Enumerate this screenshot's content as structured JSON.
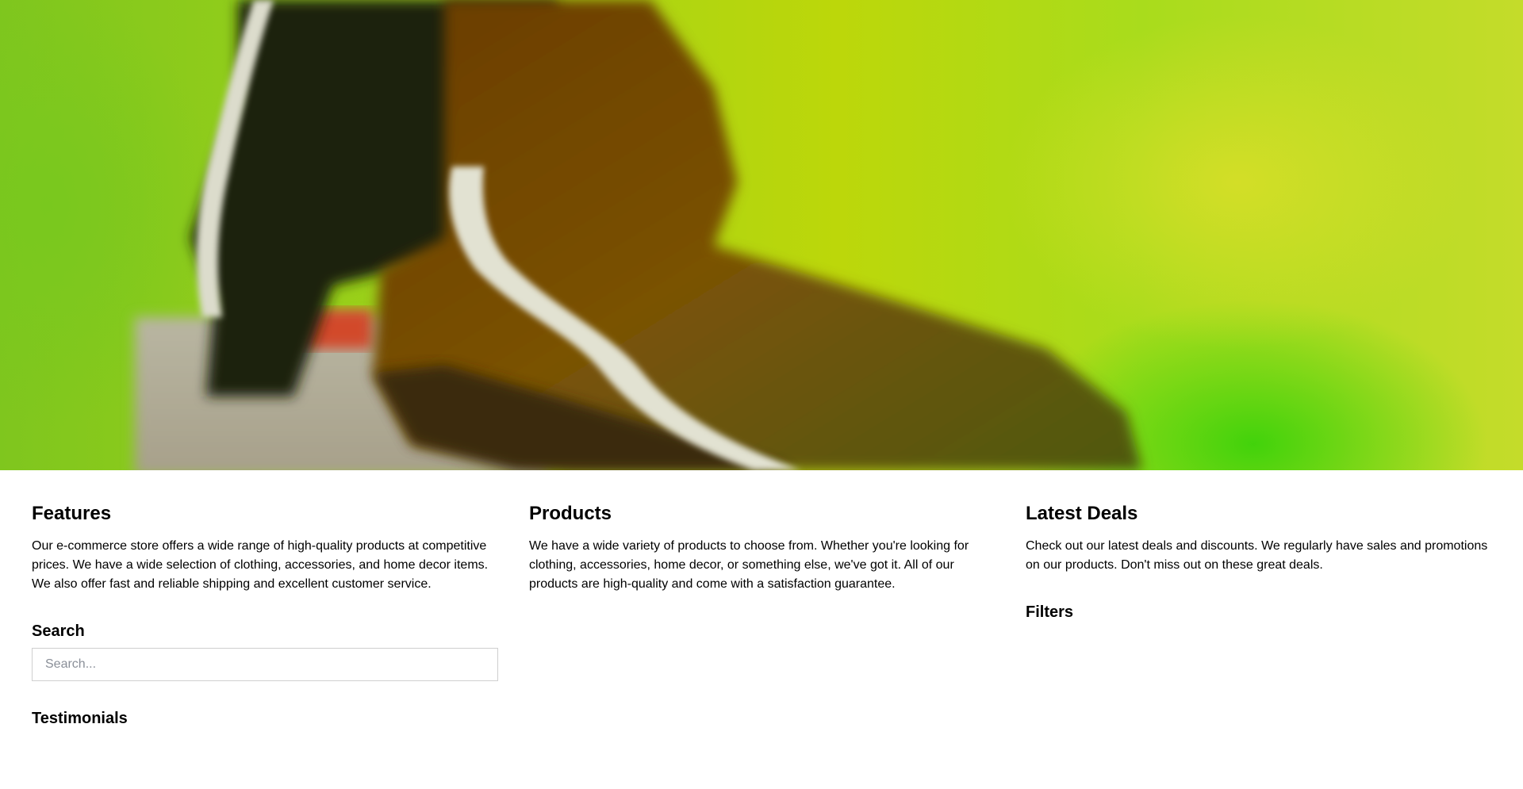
{
  "hero": {
    "image": "shoe-photo",
    "colors": {
      "background_green": "#a6d416",
      "shoe_brown": "#5a3a0a",
      "stripe_white": "#d8d8c8"
    }
  },
  "features": {
    "title": "Features",
    "text": "Our e-commerce store offers a wide range of high-quality products at competitive prices. We have a wide selection of clothing, accessories, and home decor items. We also offer fast and reliable shipping and excellent customer service."
  },
  "search": {
    "title": "Search",
    "placeholder": "Search..."
  },
  "testimonials": {
    "title": "Testimonials"
  },
  "products": {
    "title": "Products",
    "text": "We have a wide variety of products to choose from. Whether you're looking for clothing, accessories, home decor, or something else, we've got it. All of our products are high-quality and come with a satisfaction guarantee."
  },
  "deals": {
    "title": "Latest Deals",
    "text": "Check out our latest deals and discounts. We regularly have sales and promotions on our products. Don't miss out on these great deals."
  },
  "filters": {
    "title": "Filters"
  }
}
